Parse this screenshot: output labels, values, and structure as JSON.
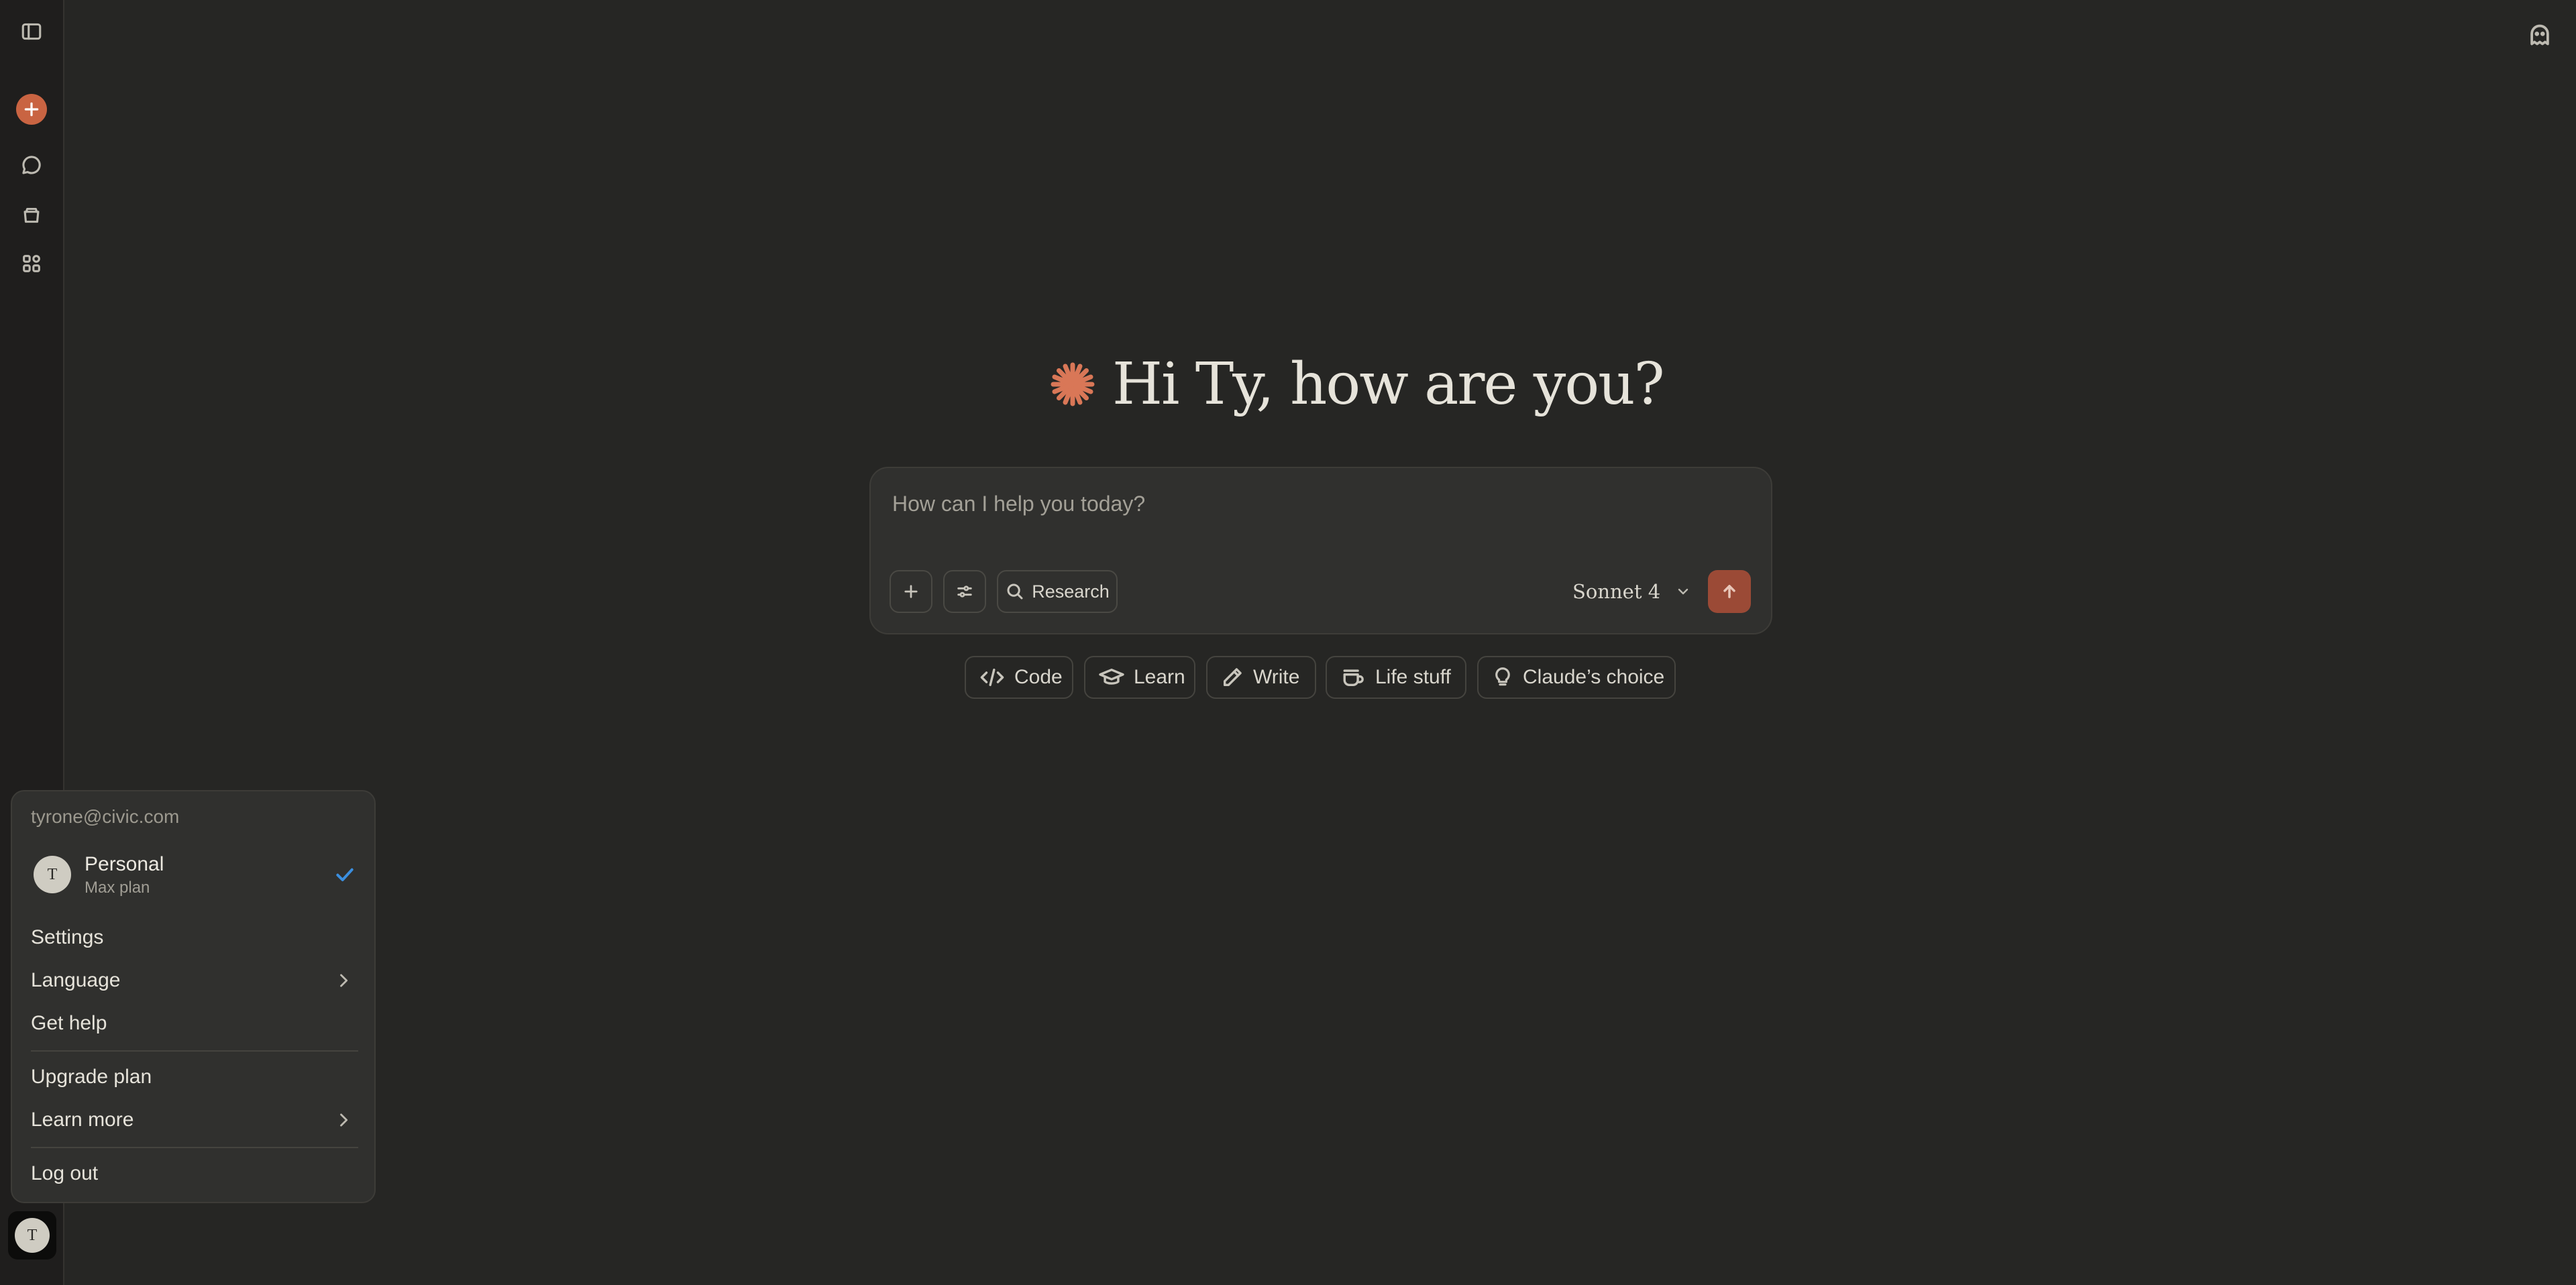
{
  "greeting": {
    "text": "Hi Ty, how are you?"
  },
  "composer": {
    "placeholder": "How can I help you today?",
    "research_label": "Research",
    "model": "Sonnet 4"
  },
  "chips": [
    {
      "label": "Code",
      "icon": "code-icon"
    },
    {
      "label": "Learn",
      "icon": "graduation-cap-icon"
    },
    {
      "label": "Write",
      "icon": "pen-icon"
    },
    {
      "label": "Life stuff",
      "icon": "coffee-cup-icon"
    },
    {
      "label": "Claude’s choice",
      "icon": "lightbulb-icon"
    }
  ],
  "account_menu": {
    "email": "tyrone@civic.com",
    "account": {
      "initial": "T",
      "name": "Personal",
      "plan": "Max plan"
    },
    "items": [
      {
        "label": "Settings"
      },
      {
        "label": "Language"
      },
      {
        "label": "Get help"
      },
      {
        "label": "Upgrade plan"
      },
      {
        "label": "Learn more"
      },
      {
        "label": "Log out"
      }
    ]
  },
  "user": {
    "initial": "T"
  },
  "colors": {
    "accent": "#c96442",
    "background": "#262624",
    "sidebar": "#1f1e1d",
    "check": "#3b8fe0"
  }
}
